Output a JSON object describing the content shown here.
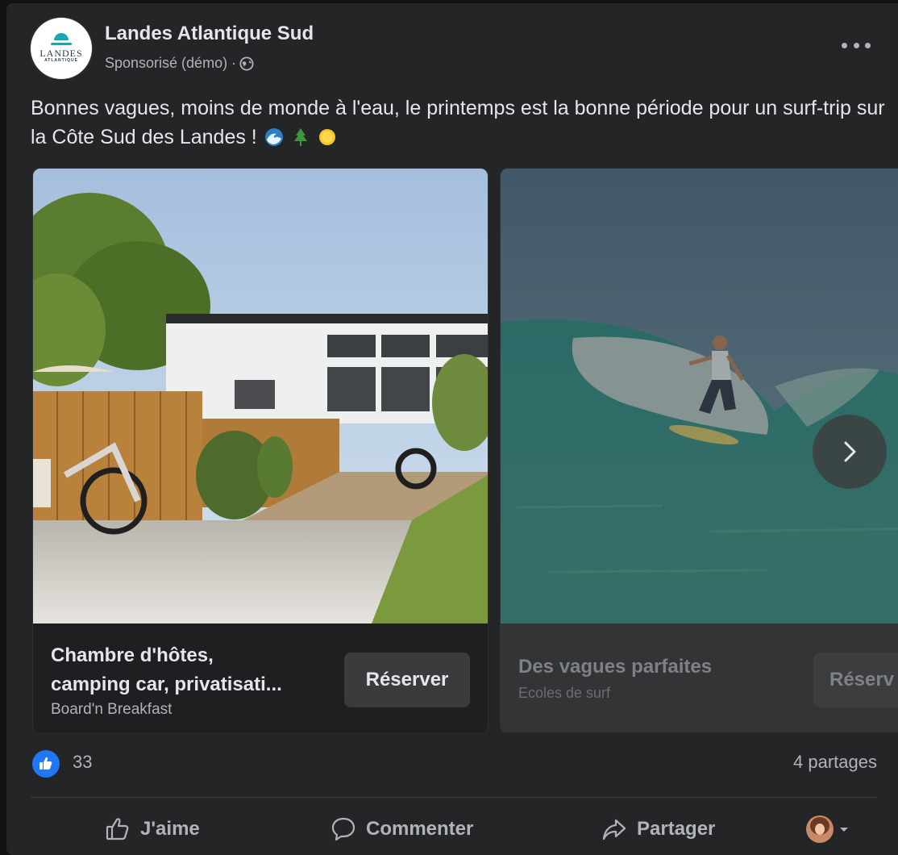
{
  "post": {
    "page_name": "Landes Atlantique Sud",
    "sponsored_label": "Sponsorisé (démo) ·",
    "avatar_logo_text": [
      "LANDES",
      "ATLANTIQUE"
    ],
    "message": "Bonnes vagues, moins de monde à l'eau, le printemps est la bonne période pour un surf-trip sur la Côte Sud des Landes !",
    "emojis": [
      "wave-icon",
      "tree-icon",
      "sun-icon"
    ]
  },
  "carousel": {
    "cards": [
      {
        "title_line1": "Chambre d'hôtes,",
        "title_line2": "camping car, privatisati...",
        "subtitle": "Board'n Breakfast",
        "cta": "Réserver"
      },
      {
        "title_line1": "Des vagues parfaites",
        "subtitle": "Ecoles de surf",
        "cta": "Réserv"
      }
    ]
  },
  "stats": {
    "likes": "33",
    "shares": "4 partages"
  },
  "actions": {
    "like": "J'aime",
    "comment": "Commenter",
    "share": "Partager"
  },
  "colors": {
    "background": "#242526",
    "text_primary": "#e4e6eb",
    "text_secondary": "#b0b3b8",
    "like_blue": "#2078f4"
  }
}
